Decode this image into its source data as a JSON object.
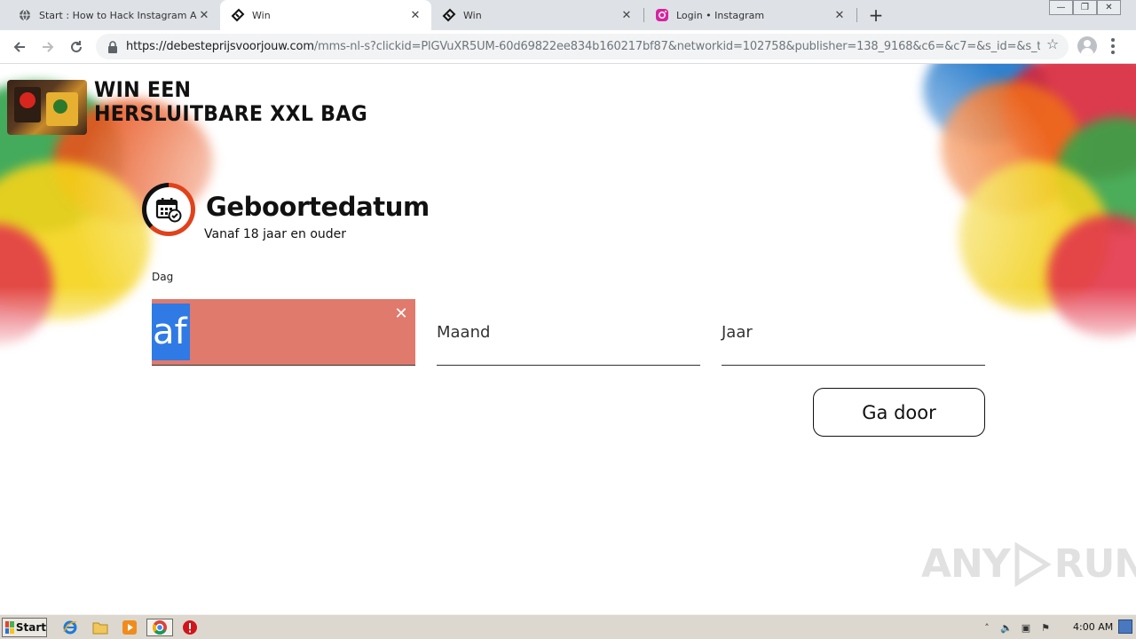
{
  "browser": {
    "tabs": [
      {
        "label": "Start : How to Hack Instagram Acco",
        "icon": "globe-icon",
        "active": false
      },
      {
        "label": "Win",
        "icon": "ticket-icon",
        "active": true
      },
      {
        "label": "Win",
        "icon": "ticket-icon",
        "active": false
      },
      {
        "label": "Login • Instagram",
        "icon": "instagram-icon",
        "active": false
      }
    ],
    "url_host": "https://debesteprijsvoorjouw.com",
    "url_path": "/mms-nl-s?clickid=PlGVuXR5UM-60d69822ee834b160217bf87&networkid=102758&publisher=138_9168&c6=&c7=&s_id=&s_ty...",
    "tab_close_glyph": "✕",
    "new_tab_glyph": "+"
  },
  "page": {
    "hero_line1": "WIN EEN",
    "hero_line2": "HERSLUITBARE XXL BAG",
    "heading": "Geboortedatum",
    "subheading": "Vanaf 18 jaar en ouder",
    "day_label": "Dag",
    "day_value": "af",
    "month_placeholder": "Maand",
    "year_placeholder": "Jaar",
    "continue_label": "Ga door",
    "accent_color": "#e0421b",
    "error_field_color": "#e07a6d"
  },
  "watermark": {
    "text_left": "ANY",
    "text_right": "RUN"
  },
  "taskbar": {
    "start_label": "Start",
    "clock": "4:00 AM",
    "pinned": [
      "ie-icon",
      "folder-icon",
      "media-player-icon",
      "chrome-icon",
      "stop-icon"
    ]
  }
}
